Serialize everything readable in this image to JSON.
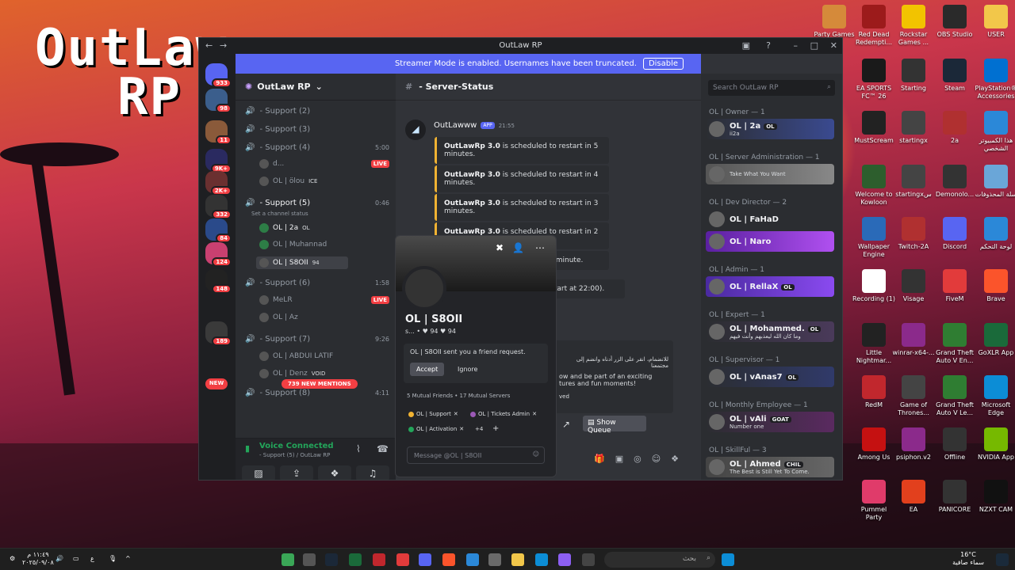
{
  "wallpaper": {
    "title_line1": "OutLaw",
    "title_line2": "RP"
  },
  "desktop_icons": [
    {
      "label": "Party Games",
      "color": "#d58a3a"
    },
    {
      "label": "Red Dead Redempti...",
      "color": "#9c1b1b"
    },
    {
      "label": "Rockstar Games ...",
      "color": "#f2c300"
    },
    {
      "label": "OBS Studio",
      "color": "#2a2a2a"
    },
    {
      "label": "USER",
      "color": "#f2c74a"
    },
    {
      "label": "EA SPORTS FC™ 26",
      "color": "#1a1a1a"
    },
    {
      "label": "Starting",
      "color": "#333333"
    },
    {
      "label": "Steam",
      "color": "#1b2838"
    },
    {
      "label": "PlayStation® Accessories",
      "color": "#0070d1"
    },
    {
      "label": "MustScream",
      "color": "#222222"
    },
    {
      "label": "startingx",
      "color": "#444444"
    },
    {
      "label": "2a",
      "color": "#b03030"
    },
    {
      "label": "هذا الكمبيوتر الشخصي",
      "color": "#2b88d8"
    },
    {
      "label": "Welcome to Kowloon",
      "color": "#2d5e2d"
    },
    {
      "label": "startingxس",
      "color": "#444444"
    },
    {
      "label": "Demonolo...",
      "color": "#333333"
    },
    {
      "label": "سلة المحذوفات",
      "color": "#6aa6d8"
    },
    {
      "label": "Wallpaper Engine",
      "color": "#2a6ab8"
    },
    {
      "label": "Twitch-2A",
      "color": "#b03030"
    },
    {
      "label": "Discord",
      "color": "#5865f2"
    },
    {
      "label": "لوحة التحكم",
      "color": "#2b88d8"
    },
    {
      "label": "Recording (1)",
      "color": "#ffffff"
    },
    {
      "label": "Visage",
      "color": "#333333"
    },
    {
      "label": "FiveM",
      "color": "#e23b3b"
    },
    {
      "label": "Brave",
      "color": "#fb542b"
    },
    {
      "label": "Little Nightmar...",
      "color": "#222222"
    },
    {
      "label": "winrar-x64-...",
      "color": "#8b2a8b"
    },
    {
      "label": "Grand Theft Auto V En...",
      "color": "#2f7d32"
    },
    {
      "label": "GoXLR App",
      "color": "#1a6a3a"
    },
    {
      "label": "RedM",
      "color": "#c1272d"
    },
    {
      "label": "Game of Thrones...",
      "color": "#444444"
    },
    {
      "label": "Grand Theft Auto V Le...",
      "color": "#2f7d32"
    },
    {
      "label": "Microsoft Edge",
      "color": "#0c8dd6"
    },
    {
      "label": "Among Us",
      "color": "#c51111"
    },
    {
      "label": "psiphon.v2",
      "color": "#8b2a8b"
    },
    {
      "label": "Offline",
      "color": "#333333"
    },
    {
      "label": "NVIDIA App",
      "color": "#76b900"
    },
    {
      "label": "Pummel Party",
      "color": "#e03b6a"
    },
    {
      "label": "EA",
      "color": "#e2401d"
    },
    {
      "label": "PANICORE",
      "color": "#333333"
    },
    {
      "label": "NZXT CAM",
      "color": "#111111"
    }
  ],
  "window": {
    "title": "OutLaw RP",
    "streamer_text": "Streamer Mode is enabled. Usernames have been truncated.",
    "streamer_button": "Disable"
  },
  "guild_badges": [
    "933",
    "98",
    "11",
    "9K+",
    "2K+",
    "332",
    "84",
    "124",
    "148",
    "189",
    "NEW"
  ],
  "server": {
    "name": "OutLaw RP"
  },
  "channels": [
    {
      "label": "- Support  (2)",
      "time": ""
    },
    {
      "label": "- Support  (3)",
      "time": ""
    },
    {
      "label": "- Support  (4)",
      "time": "5:00"
    },
    {
      "label": "- Support  (5)",
      "time": "0:46"
    },
    {
      "label": "- Support  (6)",
      "time": "1:58"
    },
    {
      "label": "- Support  (7)",
      "time": "9:26"
    },
    {
      "label": "- Support  (8)",
      "time": "4:11"
    }
  ],
  "channel_status_hint": "Set a channel status",
  "members_voice": [
    {
      "name": "d...",
      "live": "LIVE"
    },
    {
      "name": "OL | ölou",
      "tag": "ICE"
    },
    {
      "name": "OL | 2a",
      "tag": "OL"
    },
    {
      "name": "OL | Muhannad"
    },
    {
      "name": "OL | S8OII",
      "tag": "94"
    },
    {
      "name": "MeLR",
      "live": "LIVE"
    },
    {
      "name": "OL | Az"
    },
    {
      "name": "OL | ABDUI LATIF"
    },
    {
      "name": "OL | Denz",
      "tag": "VOID"
    }
  ],
  "mentions_pill": "739 NEW MENTIONS",
  "voice": {
    "status": "Voice Connected",
    "location": "- Support  (5)  / OutLaw RP"
  },
  "user": {
    "name": "2a",
    "sub": "ii2a"
  },
  "chat": {
    "channel": "- Server-Status",
    "author": "OutLawww",
    "app_tag": "APP",
    "time": "21:55",
    "messages": [
      {
        "bold": "OutLawRp 3.0",
        "text": " is scheduled to restart in 5 minutes."
      },
      {
        "bold": "OutLawRp 3.0",
        "text": " is scheduled to restart in 4 minutes."
      },
      {
        "bold": "OutLawRp 3.0",
        "text": " is scheduled to restart in 3 minutes."
      },
      {
        "bold": "OutLawRp 3.0",
        "text": " is scheduled to restart in 2 minutes."
      },
      {
        "bold": "",
        "text": "rt in 1 minute."
      },
      {
        "bold": "",
        "text": "ed restart at 22:00)."
      }
    ],
    "embed_arabic": "للانضمام، انقر على الزر أدناه وانضم إلى مجتمعنا",
    "embed_lines": [
      "ow and be part of an exciting",
      "tures and fun moments!"
    ],
    "embed_tail": "ved",
    "show_queue": "Show Queue"
  },
  "member_search_placeholder": "Search OutLaw RP",
  "member_groups": [
    {
      "role": "OL | Owner — 1",
      "members": [
        {
          "name": "OL | 2a",
          "tag": "OL",
          "sub": "ii2a"
        }
      ]
    },
    {
      "role": "OL | Server Administration — 1",
      "members": [
        {
          "name": "",
          "sub": "Take What You Want"
        }
      ]
    },
    {
      "role": "OL | Dev Director — 2",
      "members": [
        {
          "name": "OL | FaHaD",
          "sub": ""
        },
        {
          "name": "OL | Naro",
          "sub": ""
        }
      ]
    },
    {
      "role": "OL | Admin — 1",
      "members": [
        {
          "name": "OL | RellaX",
          "tag": "OL",
          "sub": ""
        }
      ]
    },
    {
      "role": "OL | Expert — 1",
      "members": [
        {
          "name": "OL | Mohammed.",
          "tag": "OL",
          "sub": "وما كان الله ليعذبهم وأنت فيهم"
        }
      ]
    },
    {
      "role": "OL | Supervisor — 1",
      "members": [
        {
          "name": "OL | vAnas7",
          "tag": "OL",
          "sub": ""
        }
      ]
    },
    {
      "role": "OL | Monthly Employee — 1",
      "members": [
        {
          "name": "OL | vAli",
          "tag": "GOAT",
          "sub": "Number one"
        }
      ]
    },
    {
      "role": "OL | SkillFul — 3",
      "members": [
        {
          "name": "OL | Ahmed",
          "tag": "CHIL",
          "sub": "The Best is Still Yet To Come."
        }
      ]
    }
  ],
  "popup": {
    "name": "OL | S8OII",
    "badges": "s... • ♥ 94   ♥ 94",
    "request_text": "OL | S8OII sent you a friend request.",
    "accept": "Accept",
    "ignore": "Ignore",
    "mutual": "5 Mutual Friends  •  17 Mutual Servers",
    "roles": [
      {
        "label": "OL | Support",
        "color": "#f0b232"
      },
      {
        "label": "OL | Tickets Admin",
        "color": "#9b59b6"
      },
      {
        "label": "OL | Activation",
        "color": "#23a55a"
      }
    ],
    "more_roles": "+4",
    "message_placeholder": "Message @OL | S8OII"
  },
  "taskbar": {
    "search": "بحث",
    "time": "١١:٤٩ م",
    "date": "٢٠٢٥/٠٩/٠٨",
    "weather_temp": "16°C",
    "weather_text": "سماء صافية",
    "lang": "ع"
  }
}
